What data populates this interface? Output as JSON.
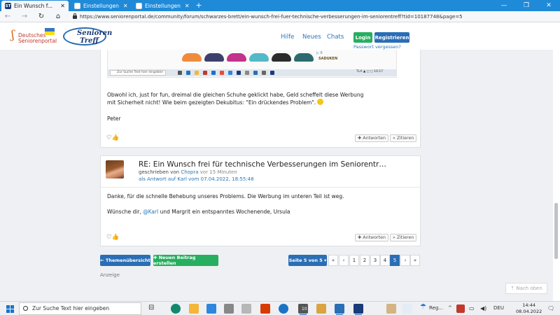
{
  "browser": {
    "tabs": [
      {
        "title": "Ein Wunsch f...",
        "favicon": "ST",
        "active": true
      },
      {
        "title": "Einstellungen",
        "active": false
      },
      {
        "title": "Einstellungen",
        "active": false
      }
    ],
    "new_tab": "+",
    "window_controls": {
      "minimize": "—",
      "maximize": "❐",
      "close": "✕"
    },
    "nav": {
      "back": "←",
      "forward": "→",
      "reload": "↻",
      "home": "⌂"
    },
    "url": "https://www.seniorenportal.de/community/forum/schwarzes-brett/ein-wunsch-frei-fuer-technische-verbesserungen-im-seniorentreff?tid=10187748&page=5"
  },
  "site_header": {
    "logo_left": {
      "mark": "ʃ",
      "line1": "Deutsches",
      "line2": "Seniorenportal"
    },
    "logo_right": {
      "line1": "Senioren",
      "line2": "Treff"
    },
    "links": [
      "Hilfe",
      "Neues",
      "Chats"
    ],
    "login": "Login",
    "register": "Registrieren",
    "forgot_password": "Passwort vergessen?"
  },
  "embedded_screenshot": {
    "ad_marker": "▷ X",
    "ad_brand": "SADUKEN",
    "search_placeholder": "Zur Suche Text hier eingeben",
    "tray_text": "TLA ▲ ◻ ◻  10:17"
  },
  "post1": {
    "body": [
      "Obwohl ich, just for fun, dreimal die gleichen Schuhe geklickt habe, Geld scheffelt diese Werbung",
      "mit Sicherheit nicht!  Wie beim gezeigten Dekubitus: \"Ein drückendes Problem\"."
    ],
    "signature": "Peter",
    "reactions": "♡👍",
    "reply": "✚ Antworten",
    "quote": "» Zitieren"
  },
  "post2": {
    "title": "RE: Ein Wunsch frei für technische Verbesserungen im Seniorentr…",
    "meta_written_by": "geschrieben von",
    "author": "Chopra",
    "time": "vor 15 Minuten",
    "reply_to": "als Antwort auf Karl vom 07.04.2022, 18:55:48",
    "body_line1": "Danke, für die schnelle Behebung unseres Problems. Die Werbung im unteren Teil ist weg.",
    "body_line2_a": "Wünsche dir, ",
    "mention": "@Karl",
    "body_line2_b": " und Margrit ein entspanntes Wochenende, Ursula",
    "reactions": "♡👍",
    "reply": "✚ Antworten",
    "quote": "» Zitieren"
  },
  "pagination": {
    "topics_button": "← Themenübersicht",
    "new_post_button": "✚ Neuen Beitrag erstellen",
    "page_select": "Seite 5 von 5 ▾",
    "first": "«",
    "prev": "‹",
    "pages": [
      "1",
      "2",
      "3",
      "4",
      "5"
    ],
    "current_page": "5",
    "next": "›",
    "last": "»"
  },
  "ad_label": "Anzeige",
  "back_to_top": "⇡ Nach oben",
  "taskbar": {
    "search_placeholder": "Zur Suche Text hier eingeben",
    "task_view": "⊟",
    "badge": "10",
    "weather": "Reg...",
    "language": "DEU",
    "time": "14:44",
    "date": "08.04.2022",
    "notification": "🗨"
  },
  "colors": {
    "tabbar": "#1f8ad8",
    "link": "#2a76b8",
    "primary_button": "#2a6eb5",
    "success_button": "#27ae60",
    "page_bg": "#eef0f3"
  }
}
